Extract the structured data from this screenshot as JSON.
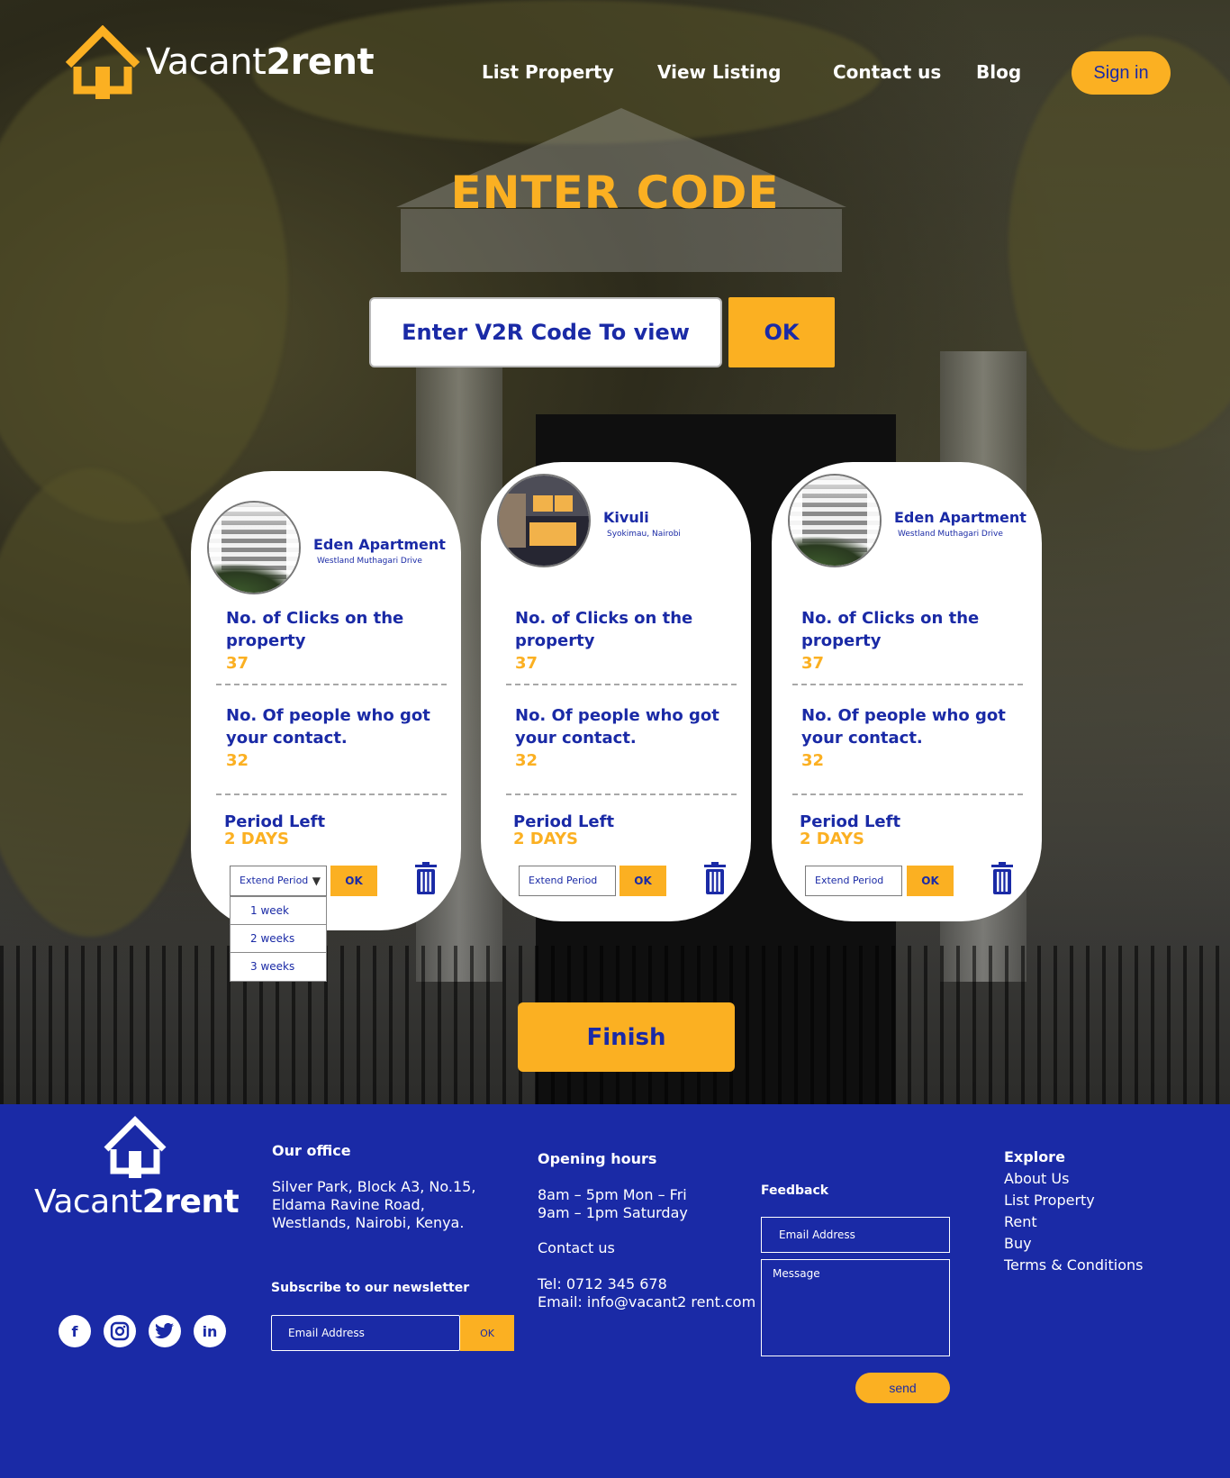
{
  "brand": {
    "name_light": "Vacant",
    "name_bold": "2rent",
    "accent": "#fbb022",
    "primary": "#1a2aa6"
  },
  "nav": {
    "links": [
      "List Property",
      "View Listing",
      "Contact us",
      "Blog"
    ],
    "signin_label": "Sign in"
  },
  "hero": {
    "title": "ENTER CODE",
    "code_placeholder": "Enter V2R Code To view",
    "ok_label": "OK"
  },
  "cards": [
    {
      "name": "Eden Apartment",
      "address": "Westland Muthagari Drive",
      "clicks_label": "No. of Clicks on the property",
      "clicks_value": "37",
      "contacts_label": "No. Of people who got your contact.",
      "contacts_value": "32",
      "period_label": "Period Left",
      "period_value": "2 DAYS",
      "extend_label": "Extend Period",
      "ok_label": "OK",
      "image": "apartment-building"
    },
    {
      "name": "Kivuli",
      "address": "Syokimau, Nairobi",
      "clicks_label": "No. of Clicks on the property",
      "clicks_value": "37",
      "contacts_label": "No. Of people who got your contact.",
      "contacts_value": "32",
      "period_label": "Period Left",
      "period_value": "2 DAYS",
      "extend_label": "Extend Period",
      "ok_label": "OK",
      "image": "modern-house"
    },
    {
      "name": "Eden Apartment",
      "address": "Westland Muthagari Drive",
      "clicks_label": "No. of Clicks on the property",
      "clicks_value": "37",
      "contacts_label": "No. Of people who got your contact.",
      "contacts_value": "32",
      "period_label": "Period Left",
      "period_value": "2 DAYS",
      "extend_label": "Extend Period",
      "ok_label": "OK",
      "image": "apartment-building"
    }
  ],
  "extend_options": [
    "1 week",
    "2 weeks",
    "3 weeks"
  ],
  "finish_label": "Finish",
  "footer": {
    "office_head": "Our office",
    "office_lines": [
      "Silver Park, Block A3, No.15,",
      "Eldama Ravine Road,",
      "Westlands, Nairobi, Kenya."
    ],
    "newsletter_head": "Subscribe to our newsletter",
    "newsletter_placeholder": "Email Address",
    "newsletter_ok": "OK",
    "hours_head": "Opening hours",
    "hours_lines": [
      "8am – 5pm Mon – Fri",
      "9am – 1pm Saturday"
    ],
    "contact_head": "Contact us",
    "contact_lines": [
      "Tel: 0712 345 678",
      "Email: info@vacant2 rent.com"
    ],
    "feedback_head": "Feedback",
    "feedback_email_placeholder": "Email Address",
    "feedback_message_placeholder": "Message",
    "send_label": "send",
    "explore_head": "Explore",
    "explore_links": [
      "About Us",
      "List Property",
      "Rent",
      "Buy",
      "Terms & Conditions"
    ],
    "social_icons": [
      "facebook-icon",
      "instagram-icon",
      "twitter-icon",
      "linkedin-icon"
    ]
  }
}
